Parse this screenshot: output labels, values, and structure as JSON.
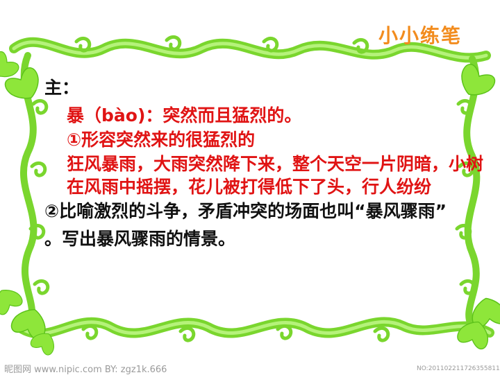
{
  "slide": {
    "title": "小小练笔",
    "lines": [
      {
        "text": "主：",
        "color": "black"
      },
      {
        "text": "暴（bào)：突然而且猛烈的。 ",
        "color": "red"
      },
      {
        "text": "①形容突然来的很猛烈的",
        "color": "red"
      },
      {
        "text": "狂风暴雨，大雨突然降下来，整个天空一片阴暗，小树",
        "color": "red"
      },
      {
        "text": "在风雨中摇摆，花儿被打得低下了头，行人纷纷",
        "color": "red"
      },
      {
        "text": "②比喻激烈的斗争，矛盾冲突的场面也叫“暴风骤雨”",
        "color": "black"
      },
      {
        "text": "。写出暴风骤雨的情景。",
        "color": "black"
      }
    ],
    "watermark_left": "昵图网 www.nipic.com   BY: zgz1k.666",
    "watermark_right": "NO:20110221172635581105"
  }
}
